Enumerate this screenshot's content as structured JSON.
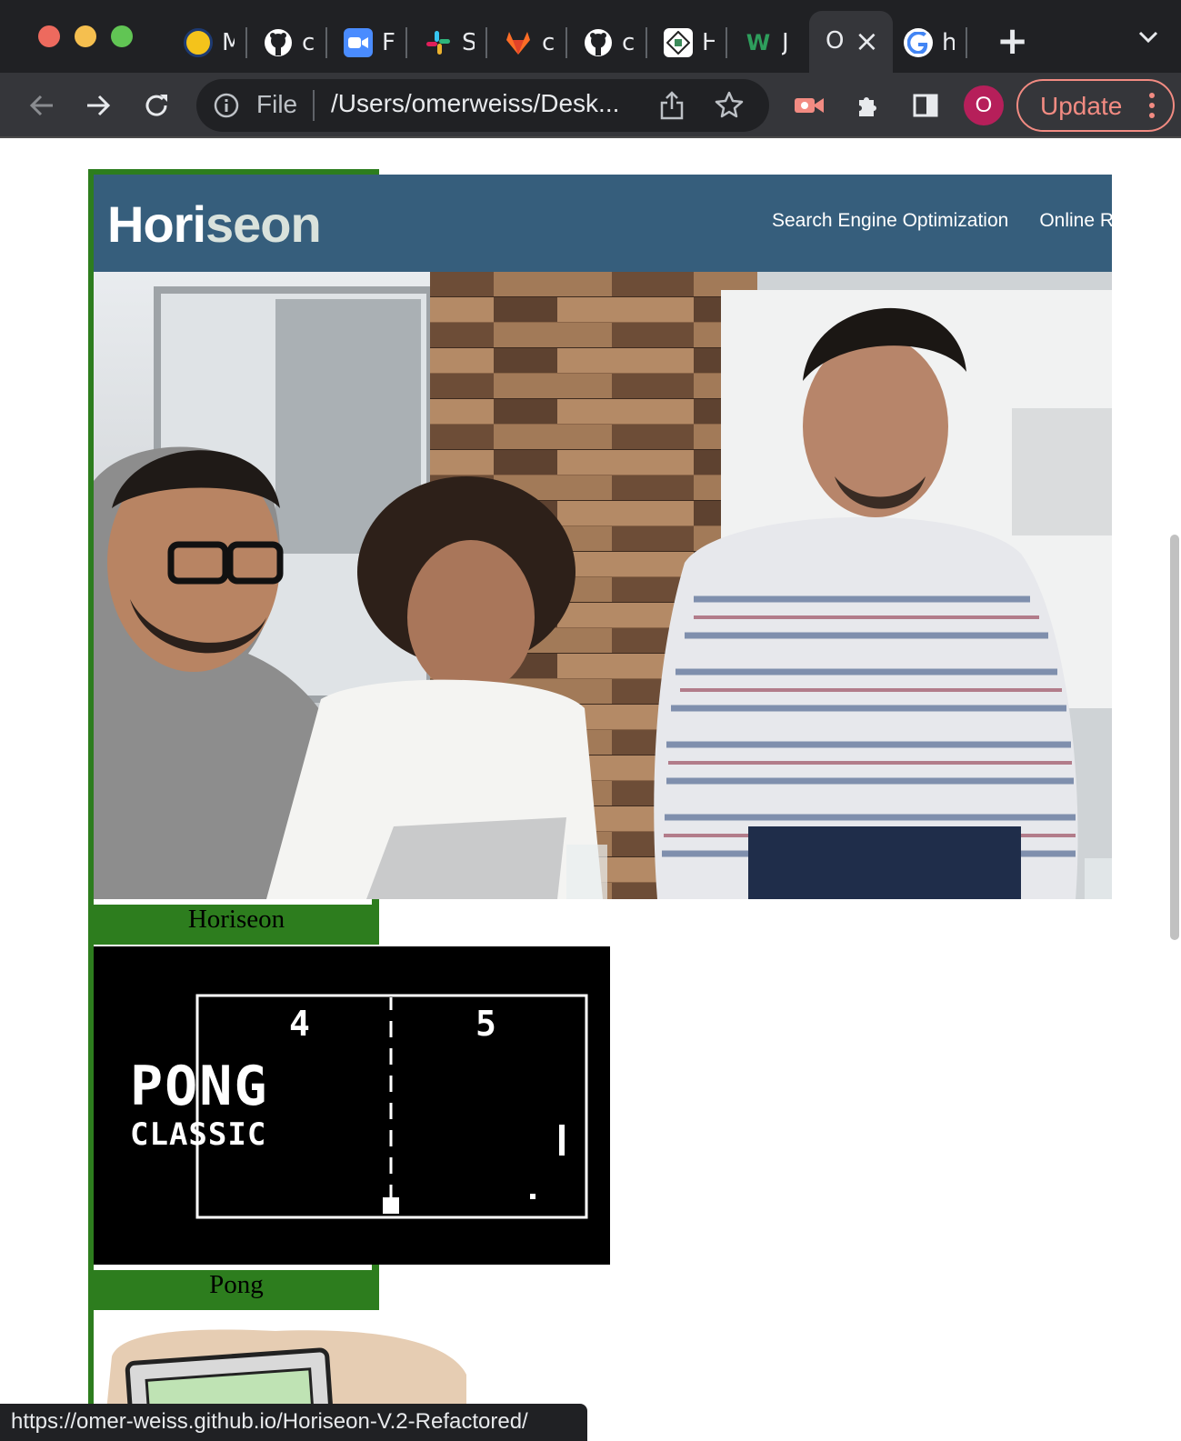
{
  "browser": {
    "window_controls": [
      "close",
      "minimize",
      "zoom"
    ],
    "tabs": [
      {
        "title": "M",
        "icon": "uc-berkeley-icon"
      },
      {
        "title": "c",
        "icon": "github-icon"
      },
      {
        "title": "F",
        "icon": "zoom-icon"
      },
      {
        "title": "S",
        "icon": "slack-icon"
      },
      {
        "title": "c",
        "icon": "gitlab-icon"
      },
      {
        "title": "c",
        "icon": "github-icon"
      },
      {
        "title": "H",
        "icon": "bootcamp-icon"
      },
      {
        "title": "J",
        "icon": "w3schools-icon"
      },
      {
        "title": "O",
        "icon": "",
        "active": true
      },
      {
        "title": "h",
        "icon": "google-icon"
      }
    ],
    "address": {
      "scheme_label": "File",
      "url": "/Users/omerweiss/Desk..."
    },
    "profile_initial": "O",
    "update_label": "Update",
    "status_url": "https://omer-weiss.github.io/Horiseon-V.2-Refactored/"
  },
  "page": {
    "site_header": {
      "logo_part1": "Hori",
      "logo_part2": "seon",
      "nav": [
        "Search Engine Optimization",
        "Online R"
      ]
    },
    "projects": [
      {
        "caption": "Horiseon",
        "image": "office-team-photo"
      },
      {
        "caption": "Pong",
        "image": "pong-classic-screenshot"
      }
    ],
    "pong": {
      "title": "PONG",
      "subtitle": "CLASSIC",
      "score_left": "4",
      "score_right": "5"
    }
  },
  "colors": {
    "accent_green": "#2d7d1e",
    "header_blue": "#365e7c",
    "update_pink": "#f28b82",
    "avatar": "#b61f5a"
  }
}
